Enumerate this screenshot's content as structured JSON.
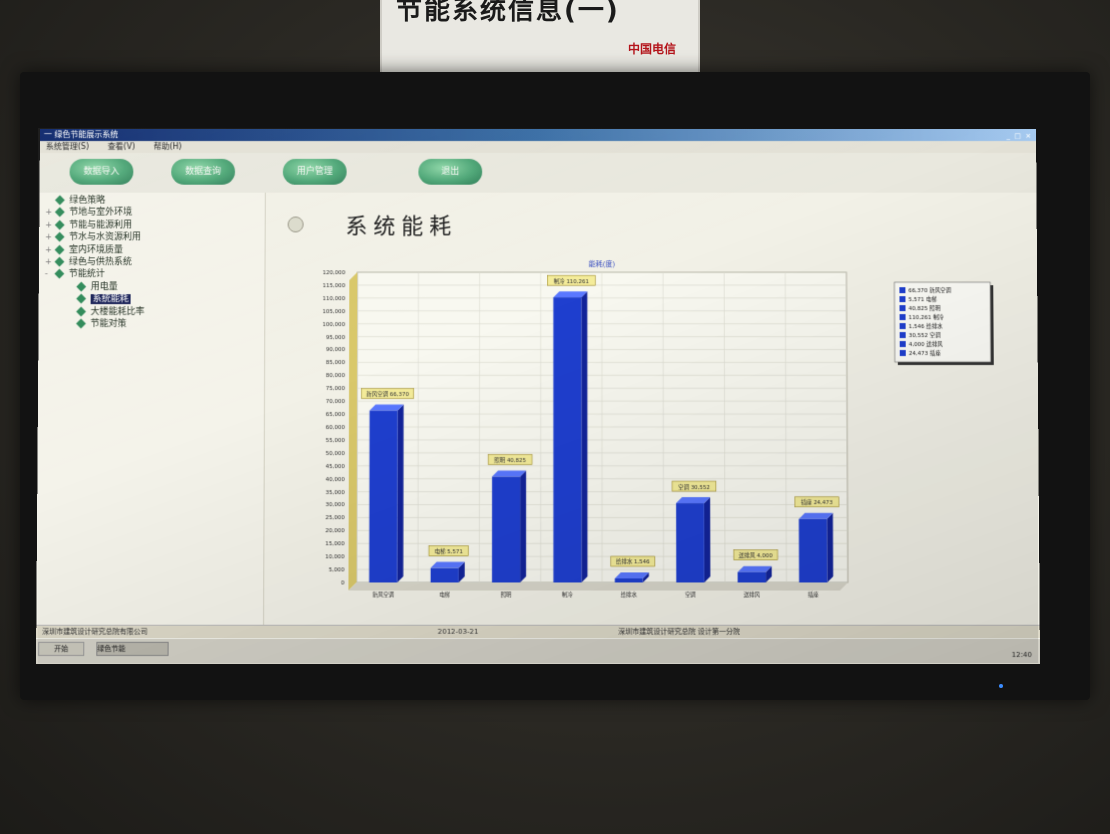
{
  "sign": {
    "title": "节能系统信息(一)",
    "sub": "中国电信"
  },
  "window": {
    "title": "一 绿色节能展示系统",
    "controls": "_ □ ×",
    "menu": [
      "系统管理(S)",
      "查看(V)",
      "帮助(H)"
    ]
  },
  "toolbar": [
    "数据导入",
    "数据查询",
    "用户管理",
    "退出"
  ],
  "tree": [
    {
      "label": "绿色策略",
      "expand": "",
      "indent": 0
    },
    {
      "label": "节地与室外环境",
      "expand": "+",
      "indent": 0
    },
    {
      "label": "节能与能源利用",
      "expand": "+",
      "indent": 0
    },
    {
      "label": "节水与水资源利用",
      "expand": "+",
      "indent": 0
    },
    {
      "label": "室内环境质量",
      "expand": "+",
      "indent": 0
    },
    {
      "label": "绿色与供热系统",
      "expand": "+",
      "indent": 0
    },
    {
      "label": "节能统计",
      "expand": "-",
      "indent": 0
    },
    {
      "label": "用电量",
      "expand": "",
      "indent": 1
    },
    {
      "label": "系统能耗",
      "expand": "",
      "indent": 1,
      "selected": true
    },
    {
      "label": "大楼能耗比率",
      "expand": "",
      "indent": 1
    },
    {
      "label": "节能对策",
      "expand": "",
      "indent": 1
    }
  ],
  "page_title": "系统能耗",
  "chart_data": {
    "type": "bar",
    "title": "能耗(度)",
    "categories": [
      "新风空调",
      "电梯",
      "照明",
      "制冷",
      "给排水",
      "空调",
      "送排风",
      "插座"
    ],
    "values": [
      66370,
      5571,
      40825,
      110261,
      1546,
      30552,
      4000,
      24473
    ],
    "ylim": [
      0,
      120000
    ],
    "ytick_step": 5000,
    "legend": [
      "66,370 新风空调",
      "5,571 电梯",
      "40,825 照明",
      "110,261 制冷",
      "1,546 给排水",
      "30,552 空调",
      "4,000 送排风",
      "24,473 插座"
    ],
    "legend_position": "right",
    "grid": true,
    "bar_color": "#1f3fcf"
  },
  "status": {
    "left": "深圳市建筑设计研究总院有限公司",
    "mid": "2012-03-21",
    "right": "深圳市建筑设计研究总院 设计第一分院"
  },
  "taskbar": {
    "start": "开始",
    "task": "绿色节能",
    "clock": "12:40"
  }
}
